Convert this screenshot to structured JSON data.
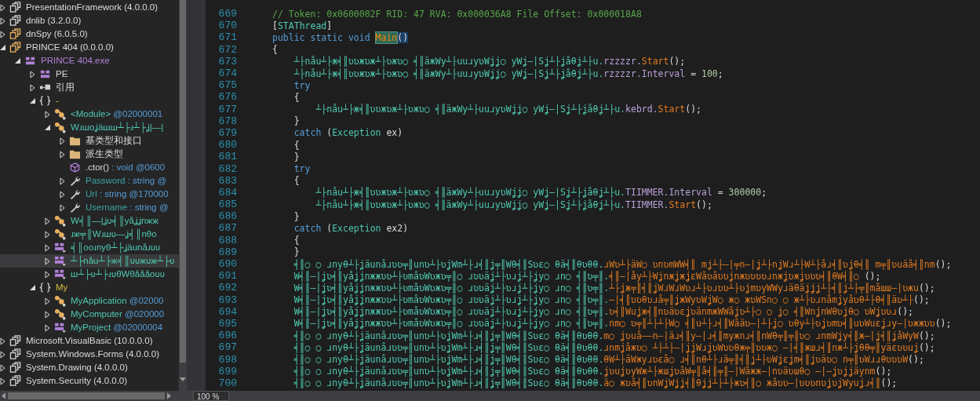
{
  "tree": [
    {
      "label": "PresentationFramework (4.0.0.0)",
      "kind": "assembly",
      "expanded": false,
      "selected": false
    },
    {
      "label": "dnlib (3.2.0.0)",
      "kind": "assembly",
      "expanded": false,
      "selected": false
    },
    {
      "label": "dnSpy (6.0.5.0)",
      "kind": "user-assembly",
      "expanded": false,
      "selected": false
    },
    {
      "label": "PRINCE 404 (0.0.0.0)",
      "kind": "user-assembly",
      "expanded": true,
      "selected": false,
      "children": [
        {
          "label": "PRINCE 404.exe",
          "kind": "module",
          "expanded": true,
          "selected": false,
          "children": [
            {
              "label": "PE",
              "kind": "pe",
              "expanded": false,
              "selected": false
            },
            {
              "label": "引用",
              "kind": "references",
              "expanded": false,
              "selected": false
            },
            {
              "label": "-",
              "kind": "namespace",
              "expanded": true,
              "selected": false,
              "children": [
                {
                  "label": "<Module>",
                  "detail": " @02000001",
                  "kind": "class",
                  "expanded": false,
                  "selected": false
                },
                {
                  "label": "Wɹшoʝäшш┴├ɹ┴├ʝ|—|",
                  "kind": "class",
                  "expanded": true,
                  "selected": false,
                  "children": [
                    {
                      "label": "基类型和接口",
                      "kind": "folder",
                      "expanded": false,
                      "selected": false
                    },
                    {
                      "label": "派生类型",
                      "kind": "folder",
                      "expanded": false,
                      "selected": false
                    },
                    {
                      "label": ".ctor()",
                      "detail": " : void @0600",
                      "kind": "method",
                      "selected": false
                    },
                    {
                      "label": "Password",
                      "detail": " : string @",
                      "kind": "property",
                      "expanded": false,
                      "selected": false
                    },
                    {
                      "label": "Url",
                      "detail": " : string @170000",
                      "kind": "property",
                      "expanded": false,
                      "selected": false
                    },
                    {
                      "label": "Username",
                      "detail": " : string @",
                      "kind": "property",
                      "expanded": false,
                      "selected": false
                    }
                  ]
                },
                {
                  "label": "W╡║—|ʝʋ╡║yåʝʝnжж",
                  "kind": "class",
                  "expanded": false,
                  "selected": false
                },
                {
                  "label": "ɹж╤║Wɹшʋ—ʝ╡║nθo",
                  "kind": "class",
                  "expanded": false,
                  "selected": false
                },
                {
                  "label": "╡║ooɹnyθ┴├ʝäunåɹʋʋ",
                  "kind": "struct",
                  "expanded": false,
                  "selected": false
                },
                {
                  "label": "┴├nåu┴├ж╡║ʋʋжʋж┴├ʋ",
                  "kind": "struct",
                  "expanded": false,
                  "selected": true
                },
                {
                  "label": "ш┴├ʋ┴├ɹʋθWθåååoʋʋ",
                  "kind": "struct",
                  "expanded": false,
                  "selected": false
                }
              ]
            },
            {
              "label": "My",
              "kind": "namespace",
              "expanded": true,
              "selected": false,
              "children": [
                {
                  "label": "MyApplication",
                  "detail": " @02000",
                  "kind": "class",
                  "expanded": false,
                  "selected": false
                },
                {
                  "label": "MyComputer",
                  "detail": " @020000",
                  "kind": "class",
                  "expanded": false,
                  "selected": false
                },
                {
                  "label": "MyProject",
                  "detail": " @02000004",
                  "kind": "struct",
                  "expanded": false,
                  "selected": false
                }
              ]
            }
          ]
        }
      ]
    },
    {
      "label": "Microsoft.VisualBasic (10.0.0.0)",
      "kind": "assembly",
      "expanded": false,
      "selected": false
    },
    {
      "label": "System.Windows.Forms (4.0.0.0)",
      "kind": "assembly",
      "expanded": false,
      "selected": false
    },
    {
      "label": "System.Drawing (4.0.0.0)",
      "kind": "assembly",
      "expanded": false,
      "selected": false
    },
    {
      "label": "System.Security (4.0.0.0)",
      "kind": "assembly",
      "expanded": false,
      "selected": false
    }
  ],
  "code": [
    {
      "number": "669",
      "tokens": [
        {
          "kind": "comment",
          "text": "// Token: 0x0600002F RID: 47 RVA: 0x000036A8 File Offset: 0x000018A8"
        }
      ]
    },
    {
      "number": "670",
      "tokens": [
        {
          "kind": "plain",
          "text": "["
        },
        {
          "kind": "type",
          "text": "STAThread"
        },
        {
          "kind": "plain",
          "text": "]"
        }
      ]
    },
    {
      "number": "671",
      "tokens": [
        {
          "kind": "keyword",
          "text": "public static void "
        },
        {
          "kind": "hl",
          "text": "Main"
        },
        {
          "kind": "hl2",
          "text": "()"
        }
      ]
    },
    {
      "number": "672",
      "tokens": [
        {
          "kind": "plain",
          "text": "{"
        }
      ]
    },
    {
      "number": "673",
      "tokens": [
        {
          "kind": "ident",
          "text": "    ┴├nåu┴├ж╡║ʋʋжʋж┴├ʋжʋ○ ╡║äжWy┴├uuɹyʋWʝʝ○ yWʝ—|Sʝ┴├ʝåθʝ┴├u."
        },
        {
          "kind": "field",
          "text": "rzzzzr."
        },
        {
          "kind": "method",
          "text": "Start"
        },
        {
          "kind": "plain",
          "text": "();"
        }
      ]
    },
    {
      "number": "674",
      "tokens": [
        {
          "kind": "ident",
          "text": "    ┴├nåu┴├ж╡║ʋʋжʋж┴├ʋжʋ○ ╡║äжWy┴├uuɹyʋWʝʝ○ yWʝ—|Sʝ┴├ʝåθʝ┴├u."
        },
        {
          "kind": "field",
          "text": "rzzzzr."
        },
        {
          "kind": "prop",
          "text": "Interval"
        },
        {
          "kind": "plain",
          "text": " = "
        },
        {
          "kind": "number",
          "text": "100"
        },
        {
          "kind": "plain",
          "text": ";"
        }
      ]
    },
    {
      "number": "675",
      "tokens": [
        {
          "kind": "keyword",
          "text": "    try"
        }
      ]
    },
    {
      "number": "676",
      "tokens": [
        {
          "kind": "plain",
          "text": "    {"
        }
      ]
    },
    {
      "number": "677",
      "tokens": [
        {
          "kind": "ident",
          "text": "        ┴├nåu┴├ж╡║ʋʋжʋж┴├ʋжʋ○ ╡║äжWy┴├uuɹyʋWʝʝ○ yWʝ—|Sʝ┴├ʝåθʝ┴├u."
        },
        {
          "kind": "field",
          "text": "kebrd."
        },
        {
          "kind": "method",
          "text": "Start"
        },
        {
          "kind": "plain",
          "text": "();"
        }
      ]
    },
    {
      "number": "678",
      "tokens": [
        {
          "kind": "plain",
          "text": "    }"
        }
      ]
    },
    {
      "number": "679",
      "tokens": [
        {
          "kind": "keyword",
          "text": "    catch"
        },
        {
          "kind": "plain",
          "text": " ("
        },
        {
          "kind": "type",
          "text": "Exception"
        },
        {
          "kind": "plain",
          "text": " ex)"
        }
      ]
    },
    {
      "number": "680",
      "tokens": [
        {
          "kind": "plain",
          "text": "    {"
        }
      ]
    },
    {
      "number": "681",
      "tokens": [
        {
          "kind": "plain",
          "text": "    }"
        }
      ]
    },
    {
      "number": "682",
      "tokens": [
        {
          "kind": "keyword",
          "text": "    try"
        }
      ]
    },
    {
      "number": "683",
      "tokens": [
        {
          "kind": "plain",
          "text": "    {"
        }
      ]
    },
    {
      "number": "684",
      "tokens": [
        {
          "kind": "ident",
          "text": "        ┴├nåu┴├ж╡║ʋʋжʋж┴├ʋжʋ○ ╡║äжWy┴├uuɹyʋWʝʝ○ yWʝ—|Sʝ┴├ʝåθʝ┴├u."
        },
        {
          "kind": "field",
          "text": "TIIMMER."
        },
        {
          "kind": "prop",
          "text": "Interval"
        },
        {
          "kind": "plain",
          "text": " = "
        },
        {
          "kind": "number",
          "text": "300000"
        },
        {
          "kind": "plain",
          "text": ";"
        }
      ]
    },
    {
      "number": "685",
      "tokens": [
        {
          "kind": "ident",
          "text": "        ┴├nåu┴├ж╡║ʋʋжʋж┴├ʋжʋ○ ╡║äжWy┴├uuɹyʋWʝʝ○ yWʝ—|Sʝ┴├ʝåθʝ┴├u."
        },
        {
          "kind": "field",
          "text": "TIIMMER."
        },
        {
          "kind": "method",
          "text": "Start"
        },
        {
          "kind": "plain",
          "text": "();"
        }
      ]
    },
    {
      "number": "686",
      "tokens": [
        {
          "kind": "plain",
          "text": "    }"
        }
      ]
    },
    {
      "number": "687",
      "tokens": [
        {
          "kind": "keyword",
          "text": "    catch"
        },
        {
          "kind": "plain",
          "text": " ("
        },
        {
          "kind": "type",
          "text": "Exception"
        },
        {
          "kind": "plain",
          "text": " ex2)"
        }
      ]
    },
    {
      "number": "688",
      "tokens": [
        {
          "kind": "plain",
          "text": "    {"
        }
      ]
    },
    {
      "number": "689",
      "tokens": [
        {
          "kind": "plain",
          "text": "    }"
        }
      ]
    },
    {
      "number": "690",
      "tokens": [
        {
          "kind": "ident",
          "text": "    ╡║○ ○ ɹnyθ┴├ʝäunåɹʋʋ╤║unʋ┴├ʋʝWm┴├ɹ╡║ʝ╤║Wθ╡║Sʋɛ○ θä╡║θʋθθ."
        },
        {
          "kind": "method",
          "text": "ɹWʋ┴├äW○ ʋnʋmWW╡║ mʝ┴├—|╤n—|ʝ┴├nʝWɹ┴├W┴├åɹ╡║ʋʝθ╡║ m╤║ʋuäå╡║nm"
        },
        {
          "kind": "plain",
          "text": "();"
        }
      ]
    },
    {
      "number": "691",
      "tokens": [
        {
          "kind": "ident",
          "text": "    W╡║—|ʝʋ╡║yåʝʝnжжʋʋ┴├ʋmåʋWʋжʋ╤║○ ɹʋʋäʝ┴├ʋɹʝ┴├ʝy○ ɹn○ ╡║ʋ╤║."
        },
        {
          "kind": "method",
          "text": "╡║—|åy┴├WʝnжʝжʝɛWåʋåʋʋʝnжʋʋʋʋɹnжʝʋжʝʋʋʋ╡║θW╡║○ "
        },
        {
          "kind": "plain",
          "text": "();"
        }
      ]
    },
    {
      "number": "692",
      "tokens": [
        {
          "kind": "ident",
          "text": "    W╡║—|ʝʋ╡║yåʝʝnжжʋʋ┴├ʋmåʋWʋжʋ╤║○ ɹʋʋäʝ┴├ʋɹʝ┴├ʝy○ ɹn○ ╡║ʋ╤║."
        },
        {
          "kind": "method",
          "text": "┴├ʝж╤║╡║ʝWɹWɹWʋɹ┴├ʋɹʋʋ┴├ʋʝmʋyWWyɹäθäʝʝʝ┴├╡║ʝ┴├╤║måшш—|ʋжu"
        },
        {
          "kind": "plain",
          "text": "();"
        }
      ]
    },
    {
      "number": "693",
      "tokens": [
        {
          "kind": "ident",
          "text": "    W╡║—|ʝʋ╡║yåʝʝnжжʋʋ┴├ʋmåʋWʋжʋ╤║○ ɹʋʋäʝ┴├ʋɹʝ┴├ʝy○ ɹn○ ╡║ʋ╤║."
        },
        {
          "kind": "method",
          "text": "—|╡║ʋʋθʋɹå╤║ʝжWyʋWʝW○ ж○ жʋWSn○ ○ ж┴├ʋɹnåmʝyåʋθ┴├θ╡║äʋ┴├"
        },
        {
          "kind": "plain",
          "text": "();"
        }
      ]
    },
    {
      "number": "694",
      "tokens": [
        {
          "kind": "ident",
          "text": "    W╡║—|ʝʋ╡║yåʝʝnжжʋʋ┴├ʋmåʋWʋжʋ╤║○ ɹʋʋäʝ┴├ʋɹʝ┴├ʝy○ ɹn○ ╡║ʋ╤║."
        },
        {
          "kind": "method",
          "text": "ʋ╡║Wuʝж╡║nʋäʋɛʝʋänmжWWåʝʋ┴├○ ○ ʝ○ ╡║WnʝnWθʋʝθ○ ʋWʝʋʋɹ"
        },
        {
          "kind": "plain",
          "text": "();"
        }
      ]
    },
    {
      "number": "695",
      "tokens": [
        {
          "kind": "ident",
          "text": "    W╡║—|ʝʋ╡║yåʝʝnжжʋʋ┴├ʋmåʋWʋжʋ╤║○ ɹʋʋäʝ┴├ʋɹʝ┴├ʝy○ ɹn○ ╡║ʋ╤║."
        },
        {
          "kind": "method",
          "text": "nm○ ʋ╤║┴├┴├W○ ╡║u┴├ɹ╡║Wåäʋ—|┴├ʝ○ ʋθy┴├ʋʝʋmʋ╡║uʋWuɛʝɹy—|ʋжжʋʋ"
        },
        {
          "kind": "plain",
          "text": "();"
        }
      ]
    },
    {
      "number": "696",
      "tokens": [
        {
          "kind": "ident",
          "text": "    ╡║○ ○ ɹnyθ┴├ʝäunåɹʋʋ╤║unʋ┴├ʋʝWm┴├ɹ╡║ʝ╤║Wθ╡║Sʋɛ○ θä╡║θʋθθ."
        },
        {
          "kind": "method",
          "text": "m○ ʝʋuå——n—|äɹ╡║y—|ɹ╡║myжnɹ╡║nWθ╤║╤║ʋ○ ɹnmWʝy╡║ж—|ʝ╡║ʝåWyW"
        },
        {
          "kind": "plain",
          "text": "();"
        }
      ]
    },
    {
      "number": "697",
      "tokens": [
        {
          "kind": "ident",
          "text": "    ╡║○ ○ ɹnyθ┴├ʝäunåɹʋʋ╤║unʋ┴├ʋʝWm┴├ɹ╡║ʝ╤║Wθ╡║Sʋɛ○ θä╡║θʋθθ."
        },
        {
          "kind": "method",
          "text": "ɹnmʝåжʋ○ ┴├┴├—|ʝʝWɹʝʋWʋʋθж╤║ʋʋж○ —|╡║жшɹ╡║nж┴├ʝθθ╤║yäɛʋʋuʝ"
        },
        {
          "kind": "plain",
          "text": "();"
        }
      ]
    },
    {
      "number": "698",
      "tokens": [
        {
          "kind": "ident",
          "text": "    ╡║○ ○ ɹnyθ┴├ʝäunåɹʋʋ╤║unʋ┴├ʋʝWm┴├ɹ╡║ʝ╤║Wθ╡║Sʋɛ○ θä╡║θʋθθ."
        },
        {
          "kind": "method",
          "text": "θW┴├äWжyɹʋɛå○ ɹ╡║nθ┴├ɹä╤║╡║ʝ┴├ʋWʝɛʝm╡║ʝʋäʋ○ n╤║ʋWɹɹθʋʋʋW"
        },
        {
          "kind": "plain",
          "text": "();"
        }
      ]
    },
    {
      "number": "699",
      "tokens": [
        {
          "kind": "ident",
          "text": "    ╡║○ ○ ɹnyθ┴├ʝäunåɹʋʋ╤║unʋ┴├ʋʝWm┴├ɹ╡║ʝ╤║Wθ╡║Sʋɛ○ θä╡║θʋθθ."
        },
        {
          "kind": "method",
          "text": "ʝʋuʝʋyWж┴├жшʝʋåW╤║å╡║╤║—|Wåжж—|nʋäʋшθ○ —|—ʝʋʝʝäynm"
        },
        {
          "kind": "plain",
          "text": "();"
        }
      ]
    },
    {
      "number": "700",
      "tokens": [
        {
          "kind": "ident",
          "text": "    ╡║○ ○ ɹnyθ┴├ʝäunåɹʋʋ╤║unʋ┴├ʋʝWm┴├ɹ╡║ʝ╤║Wθ╡║Sʋɛ○ θä╡║θʋθθ."
        },
        {
          "kind": "method",
          "text": "ä○ жʋå╡║ʋnWʝWʝʝ╡║θʝʝ┴├┴├жʋ╡║○ жåʋʋ—|ʋʋʋnʋʝʋʝWyuʝɹ╡║"
        },
        {
          "kind": "plain",
          "text": "();"
        }
      ]
    }
  ],
  "zoom": "100 %"
}
